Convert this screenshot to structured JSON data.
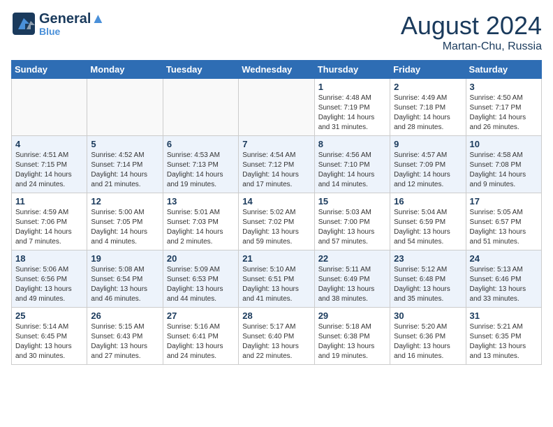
{
  "header": {
    "logo_line1": "General",
    "logo_line2": "Blue",
    "month_year": "August 2024",
    "location": "Martan-Chu, Russia"
  },
  "days_of_week": [
    "Sunday",
    "Monday",
    "Tuesday",
    "Wednesday",
    "Thursday",
    "Friday",
    "Saturday"
  ],
  "weeks": [
    [
      {
        "day": "",
        "info": ""
      },
      {
        "day": "",
        "info": ""
      },
      {
        "day": "",
        "info": ""
      },
      {
        "day": "",
        "info": ""
      },
      {
        "day": "1",
        "info": "Sunrise: 4:48 AM\nSunset: 7:19 PM\nDaylight: 14 hours\nand 31 minutes."
      },
      {
        "day": "2",
        "info": "Sunrise: 4:49 AM\nSunset: 7:18 PM\nDaylight: 14 hours\nand 28 minutes."
      },
      {
        "day": "3",
        "info": "Sunrise: 4:50 AM\nSunset: 7:17 PM\nDaylight: 14 hours\nand 26 minutes."
      }
    ],
    [
      {
        "day": "4",
        "info": "Sunrise: 4:51 AM\nSunset: 7:15 PM\nDaylight: 14 hours\nand 24 minutes."
      },
      {
        "day": "5",
        "info": "Sunrise: 4:52 AM\nSunset: 7:14 PM\nDaylight: 14 hours\nand 21 minutes."
      },
      {
        "day": "6",
        "info": "Sunrise: 4:53 AM\nSunset: 7:13 PM\nDaylight: 14 hours\nand 19 minutes."
      },
      {
        "day": "7",
        "info": "Sunrise: 4:54 AM\nSunset: 7:12 PM\nDaylight: 14 hours\nand 17 minutes."
      },
      {
        "day": "8",
        "info": "Sunrise: 4:56 AM\nSunset: 7:10 PM\nDaylight: 14 hours\nand 14 minutes."
      },
      {
        "day": "9",
        "info": "Sunrise: 4:57 AM\nSunset: 7:09 PM\nDaylight: 14 hours\nand 12 minutes."
      },
      {
        "day": "10",
        "info": "Sunrise: 4:58 AM\nSunset: 7:08 PM\nDaylight: 14 hours\nand 9 minutes."
      }
    ],
    [
      {
        "day": "11",
        "info": "Sunrise: 4:59 AM\nSunset: 7:06 PM\nDaylight: 14 hours\nand 7 minutes."
      },
      {
        "day": "12",
        "info": "Sunrise: 5:00 AM\nSunset: 7:05 PM\nDaylight: 14 hours\nand 4 minutes."
      },
      {
        "day": "13",
        "info": "Sunrise: 5:01 AM\nSunset: 7:03 PM\nDaylight: 14 hours\nand 2 minutes."
      },
      {
        "day": "14",
        "info": "Sunrise: 5:02 AM\nSunset: 7:02 PM\nDaylight: 13 hours\nand 59 minutes."
      },
      {
        "day": "15",
        "info": "Sunrise: 5:03 AM\nSunset: 7:00 PM\nDaylight: 13 hours\nand 57 minutes."
      },
      {
        "day": "16",
        "info": "Sunrise: 5:04 AM\nSunset: 6:59 PM\nDaylight: 13 hours\nand 54 minutes."
      },
      {
        "day": "17",
        "info": "Sunrise: 5:05 AM\nSunset: 6:57 PM\nDaylight: 13 hours\nand 51 minutes."
      }
    ],
    [
      {
        "day": "18",
        "info": "Sunrise: 5:06 AM\nSunset: 6:56 PM\nDaylight: 13 hours\nand 49 minutes."
      },
      {
        "day": "19",
        "info": "Sunrise: 5:08 AM\nSunset: 6:54 PM\nDaylight: 13 hours\nand 46 minutes."
      },
      {
        "day": "20",
        "info": "Sunrise: 5:09 AM\nSunset: 6:53 PM\nDaylight: 13 hours\nand 44 minutes."
      },
      {
        "day": "21",
        "info": "Sunrise: 5:10 AM\nSunset: 6:51 PM\nDaylight: 13 hours\nand 41 minutes."
      },
      {
        "day": "22",
        "info": "Sunrise: 5:11 AM\nSunset: 6:49 PM\nDaylight: 13 hours\nand 38 minutes."
      },
      {
        "day": "23",
        "info": "Sunrise: 5:12 AM\nSunset: 6:48 PM\nDaylight: 13 hours\nand 35 minutes."
      },
      {
        "day": "24",
        "info": "Sunrise: 5:13 AM\nSunset: 6:46 PM\nDaylight: 13 hours\nand 33 minutes."
      }
    ],
    [
      {
        "day": "25",
        "info": "Sunrise: 5:14 AM\nSunset: 6:45 PM\nDaylight: 13 hours\nand 30 minutes."
      },
      {
        "day": "26",
        "info": "Sunrise: 5:15 AM\nSunset: 6:43 PM\nDaylight: 13 hours\nand 27 minutes."
      },
      {
        "day": "27",
        "info": "Sunrise: 5:16 AM\nSunset: 6:41 PM\nDaylight: 13 hours\nand 24 minutes."
      },
      {
        "day": "28",
        "info": "Sunrise: 5:17 AM\nSunset: 6:40 PM\nDaylight: 13 hours\nand 22 minutes."
      },
      {
        "day": "29",
        "info": "Sunrise: 5:18 AM\nSunset: 6:38 PM\nDaylight: 13 hours\nand 19 minutes."
      },
      {
        "day": "30",
        "info": "Sunrise: 5:20 AM\nSunset: 6:36 PM\nDaylight: 13 hours\nand 16 minutes."
      },
      {
        "day": "31",
        "info": "Sunrise: 5:21 AM\nSunset: 6:35 PM\nDaylight: 13 hours\nand 13 minutes."
      }
    ]
  ]
}
